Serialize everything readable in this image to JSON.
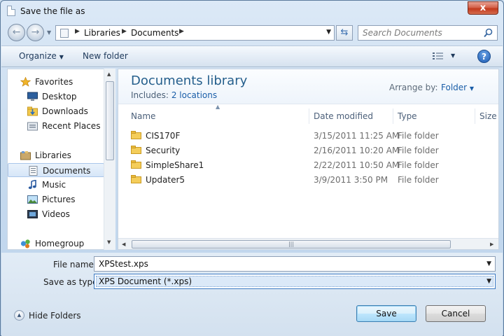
{
  "window": {
    "title": "Save the file as",
    "close_label": "x"
  },
  "address": {
    "crumbs": [
      "Libraries",
      "Documents"
    ],
    "search_placeholder": "Search Documents"
  },
  "toolbar": {
    "organize_label": "Organize",
    "new_folder_label": "New folder",
    "help_label": "?"
  },
  "sidebar": {
    "items": [
      {
        "label": "Favorites",
        "icon": "star-icon"
      },
      {
        "label": "Desktop",
        "icon": "desktop-icon"
      },
      {
        "label": "Downloads",
        "icon": "downloads-folder-icon"
      },
      {
        "label": "Recent Places",
        "icon": "recent-places-icon"
      },
      {
        "label": "Libraries",
        "icon": "libraries-icon"
      },
      {
        "label": "Documents",
        "icon": "documents-icon",
        "selected": true
      },
      {
        "label": "Music",
        "icon": "music-icon"
      },
      {
        "label": "Pictures",
        "icon": "pictures-icon"
      },
      {
        "label": "Videos",
        "icon": "videos-icon"
      },
      {
        "label": "Homegroup",
        "icon": "homegroup-icon"
      }
    ]
  },
  "library": {
    "title": "Documents library",
    "includes_prefix": "Includes:",
    "includes_link": "2 locations",
    "arrange_label": "Arrange by:",
    "arrange_value": "Folder"
  },
  "columns": {
    "name": "Name",
    "date": "Date modified",
    "type": "Type",
    "size": "Size"
  },
  "files": [
    {
      "name": "CIS170F",
      "date": "3/15/2011 11:25 AM",
      "type": "File folder"
    },
    {
      "name": "Security",
      "date": "2/16/2011 10:20 AM",
      "type": "File folder"
    },
    {
      "name": "SimpleShare1",
      "date": "2/22/2011 10:50 AM",
      "type": "File folder"
    },
    {
      "name": "Updater5",
      "date": "3/9/2011 3:50 PM",
      "type": "File folder"
    }
  ],
  "form": {
    "file_name_label": "File name:",
    "file_name_value": "XPStest.xps",
    "save_type_label": "Save as type:",
    "save_type_value": "XPS Document (*.xps)"
  },
  "footer": {
    "hide_folders_label": "Hide Folders",
    "save_label": "Save",
    "cancel_label": "Cancel"
  },
  "colors": {
    "accent": "#1a5ea8",
    "selection": "#d6e6f8",
    "close": "#c2391d"
  }
}
